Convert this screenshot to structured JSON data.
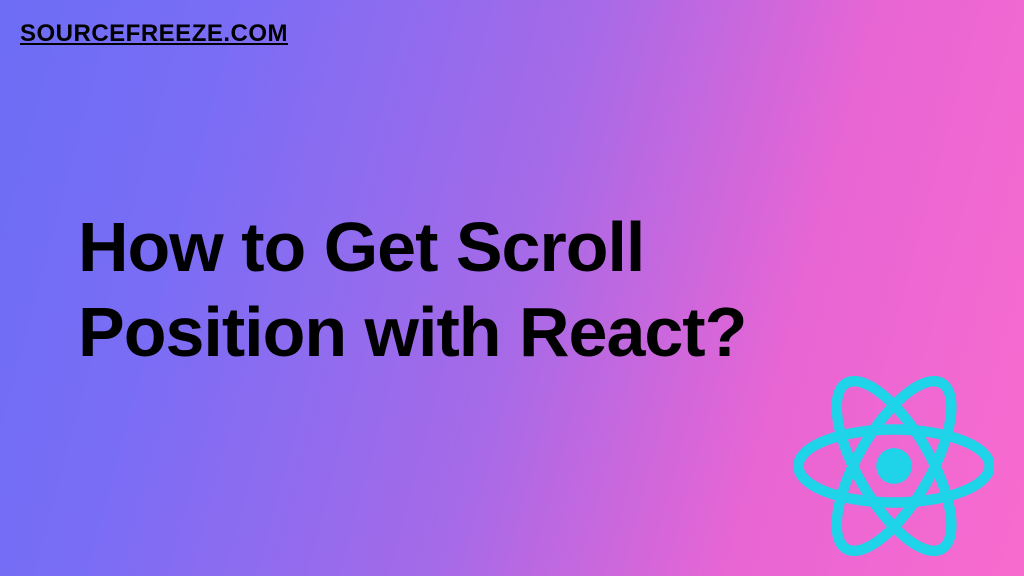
{
  "brand": "SOURCEFREEZE.COM",
  "title_line1": "How to Get Scroll",
  "title_line2": "Position with React?",
  "logo": {
    "name": "react-logo",
    "color": "#1fd3e8"
  }
}
